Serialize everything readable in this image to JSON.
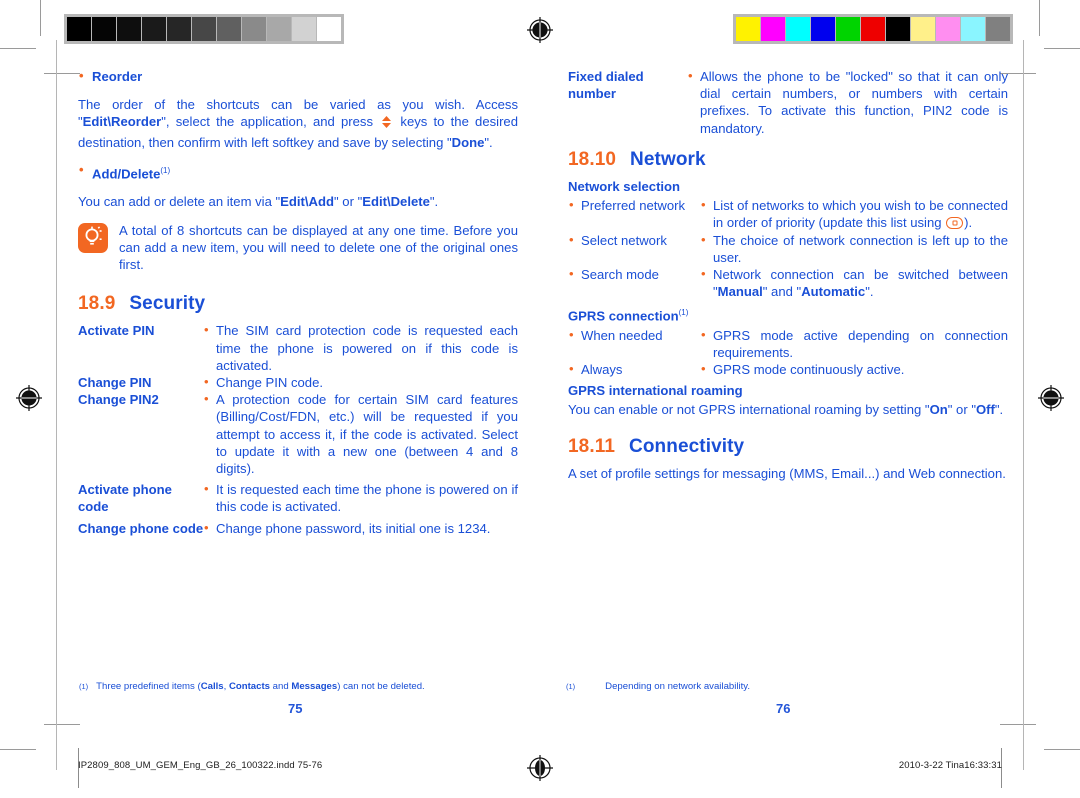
{
  "document": {
    "type": "printed-manual-spread",
    "colors": {
      "text_blue": "#1A4FD6",
      "accent_orange": "#F26722",
      "folio_blue": "#2355D8"
    },
    "gray_calibration_swatches": [
      "#000000",
      "#050505",
      "#0e0e0e",
      "#1a1a1a",
      "#262626",
      "#474747",
      "#606060",
      "#8a8a8a",
      "#a8a8a8",
      "#d2d2d2",
      "#ffffff"
    ],
    "color_calibration_swatches": [
      "#fff200",
      "#ff00ff",
      "#00ffff",
      "#0000ee",
      "#00d400",
      "#ee0000",
      "#000000",
      "#fff08a",
      "#ff8ef0",
      "#8af5ff",
      "#808080"
    ]
  },
  "left_page": {
    "page_number": "75",
    "reorder": {
      "heading": "Reorder",
      "paragraph_part1": "The order of the shortcuts can be varied as you wish. Access \"",
      "bold_edit_reorder": "Edit\\Reorder",
      "paragraph_part2": "\", select the application, and press ",
      "paragraph_part3": " keys to the desired destination, then confirm with left softkey and save by selecting \"",
      "bold_done": "Done",
      "paragraph_part4": "\"."
    },
    "add_delete": {
      "heading": "Add/Delete",
      "footnote_marker": "(1)",
      "paragraph_part1": "You can add or delete an item via \"",
      "bold_edit_add": "Edit\\Add",
      "paragraph_part2": "\" or \"",
      "bold_edit_delete": "Edit\\Delete",
      "paragraph_part3": "\"."
    },
    "tip": {
      "icon": "lightbulb-icon",
      "text": "A total of 8 shortcuts can be displayed at any one time. Before you can add a new item, you will need to delete one of the original ones first."
    },
    "security_section": {
      "number": "18.9",
      "title": "Security",
      "rows": [
        {
          "term": "Activate PIN",
          "desc": "The SIM card protection code is requested each time the phone is powered on if this code is activated."
        },
        {
          "term": "Change PIN",
          "desc": "Change PIN code."
        },
        {
          "term": "Change PIN2",
          "desc": "A protection code for certain SIM card features (Billing/Cost/FDN, etc.) will be requested if you attempt to access it, if the code is activated. Select to update it with a new one (between 4 and 8 digits)."
        },
        {
          "term": "Activate phone code",
          "desc": "It is requested each time the phone is powered on if this code is activated."
        },
        {
          "term": "Change phone code",
          "desc": "Change phone password, its initial one is 1234."
        }
      ]
    },
    "footnote": {
      "marker": "(1)",
      "text_part1": "Three predefined items (",
      "bold_calls": "Calls",
      "text_part2": ", ",
      "bold_contacts": "Contacts",
      "text_part3": " and ",
      "bold_messages": "Messages",
      "text_part4": ") can not be deleted."
    }
  },
  "right_page": {
    "page_number": "76",
    "fixed_dialed": {
      "term": "Fixed dialed number",
      "desc": "Allows the phone to be \"locked\" so that it can only dial certain numbers, or numbers with certain prefixes. To activate this function, PIN2 code is mandatory."
    },
    "network_section": {
      "number": "18.10",
      "title": "Network",
      "network_selection_heading": "Network selection",
      "network_rows": [
        {
          "term": "Preferred network",
          "desc_part1": "List of networks to which you wish to be connected in order of priority (update this list using ",
          "desc_part2": ")."
        },
        {
          "term": "Select network",
          "desc_part1": "The choice of network connection is left up to the user.",
          "desc_part2": ""
        },
        {
          "term": "Search mode",
          "desc_part1": "Network connection can be switched between \"",
          "bold_manual": "Manual",
          "desc_mid": "\" and \"",
          "bold_automatic": "Automatic",
          "desc_part2": "\"."
        }
      ],
      "gprs_connection_heading": "GPRS connection",
      "gprs_connection_footnote": "(1)",
      "gprs_rows": [
        {
          "term": "When needed",
          "desc": "GPRS mode active depending on connection requirements."
        },
        {
          "term": "Always",
          "desc": "GPRS mode continuously active."
        }
      ],
      "gprs_roaming_heading": "GPRS international roaming",
      "gprs_roaming_part1": "You can enable or not GPRS international roaming by setting \"",
      "gprs_roaming_on": "On",
      "gprs_roaming_part2": "\" or \"",
      "gprs_roaming_off": "Off",
      "gprs_roaming_part3": "\"."
    },
    "connectivity_section": {
      "number": "18.11",
      "title": "Connectivity",
      "paragraph": "A set of profile settings for messaging (MMS, Email...) and Web connection."
    },
    "footnote": {
      "marker": "(1)",
      "text": "Depending on network availability."
    }
  },
  "slug": {
    "filename": "IP2809_808_UM_GEM_Eng_GB_26_100322.indd   75-76",
    "timestamp": "2010-3-22   Tina16:33:31"
  }
}
